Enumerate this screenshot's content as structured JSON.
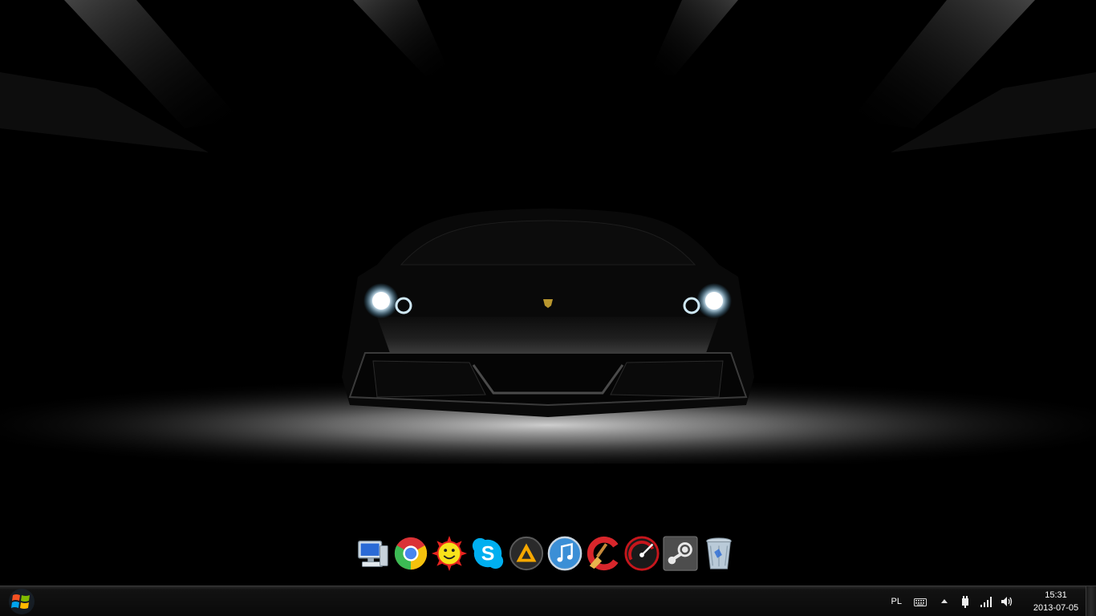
{
  "desktop": {
    "wallpaper": "black sports car in a dark garage"
  },
  "dock": {
    "items": [
      {
        "name": "computer",
        "icon": "computer-icon"
      },
      {
        "name": "chrome",
        "icon": "chrome-icon"
      },
      {
        "name": "gadu",
        "icon": "sun-smiley-icon"
      },
      {
        "name": "skype",
        "icon": "skype-icon"
      },
      {
        "name": "aimp",
        "icon": "aimp-icon"
      },
      {
        "name": "itunes",
        "icon": "itunes-icon"
      },
      {
        "name": "ccleaner",
        "icon": "ccleaner-icon"
      },
      {
        "name": "speed",
        "icon": "speedometer-icon"
      },
      {
        "name": "steam",
        "icon": "steam-icon"
      },
      {
        "name": "recycle-bin",
        "icon": "recycle-bin-icon"
      }
    ]
  },
  "taskbar": {
    "language": "PL",
    "time": "15:31",
    "date": "2013-07-05"
  },
  "colors": {
    "taskbar_bg": "#0a0a0a",
    "text": "#ffffff"
  }
}
